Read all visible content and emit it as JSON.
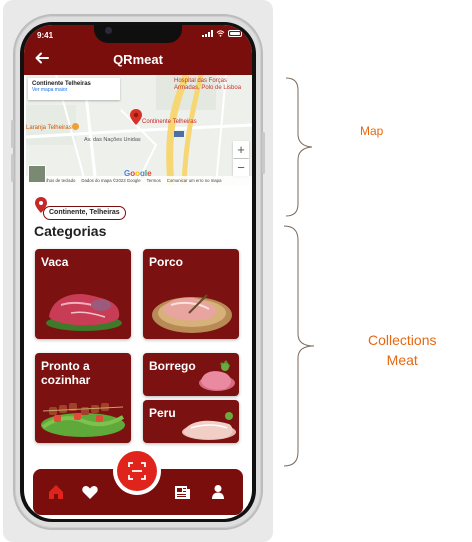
{
  "status_bar": {
    "time": "9:41"
  },
  "header": {
    "title": "QRmeat"
  },
  "map": {
    "place_name": "Continente Telheiras",
    "place_link": "Ver mapa maior",
    "pin_label": "Continente Telheiras",
    "poi_top": "Hospital das Forças Armadas, Polo de Lisboa",
    "poi_left": "Laranja Telheiras",
    "street": "Av. das Nações Unidas",
    "footer": [
      "Atalhos de teclado",
      "Dados do mapa ©2023 Google",
      "Termos",
      "Comunicar um erro no mapa"
    ],
    "brand": "Google",
    "zoom_in": "+",
    "zoom_out": "−"
  },
  "location_chip": "Continente, Telheiras",
  "section_title": "Categorias",
  "categories": [
    {
      "label": "Vaca"
    },
    {
      "label": "Porco"
    },
    {
      "label": "Pronto a cozinhar"
    },
    {
      "label": "Borrego"
    },
    {
      "label": "Peru"
    }
  ],
  "nav": [
    "home-icon",
    "heart-icon",
    "qr-scan-icon",
    "news-icon",
    "user-icon"
  ],
  "annotations": {
    "map": "Map",
    "collections": "Collections\nMeat"
  },
  "colors": {
    "brand": "#7a0e0c",
    "accent": "#e0241c",
    "annotation": "#e8670f"
  }
}
